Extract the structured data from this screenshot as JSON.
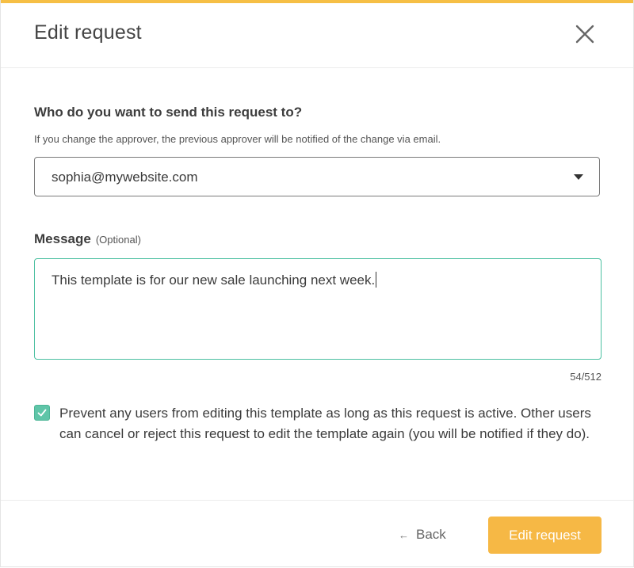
{
  "header": {
    "title": "Edit request"
  },
  "recipient": {
    "label": "Who do you want to send this request to?",
    "help": "If you change the approver, the previous approver will be notified of the change via email.",
    "selected": "sophia@mywebsite.com"
  },
  "message": {
    "label": "Message",
    "optional": "(Optional)",
    "value": "This template is for our new sale launching next week.",
    "counter": "54/512"
  },
  "lock_option": {
    "checked": true,
    "label": "Prevent any users from editing this template as long as this request is active. Other users can cancel or reject this request to edit the template again (you will be notified if they do)."
  },
  "footer": {
    "back_label": "Back",
    "submit_label": "Edit request"
  },
  "colors": {
    "accent": "#f6bf45",
    "primary_button": "#f6b845",
    "focus_border": "#4cc0a1",
    "checkbox": "#5fc5a8"
  },
  "icons": {
    "close": "close-icon",
    "dropdown": "caret-down-icon",
    "check": "checkmark-icon",
    "back": "arrow-left-icon"
  }
}
